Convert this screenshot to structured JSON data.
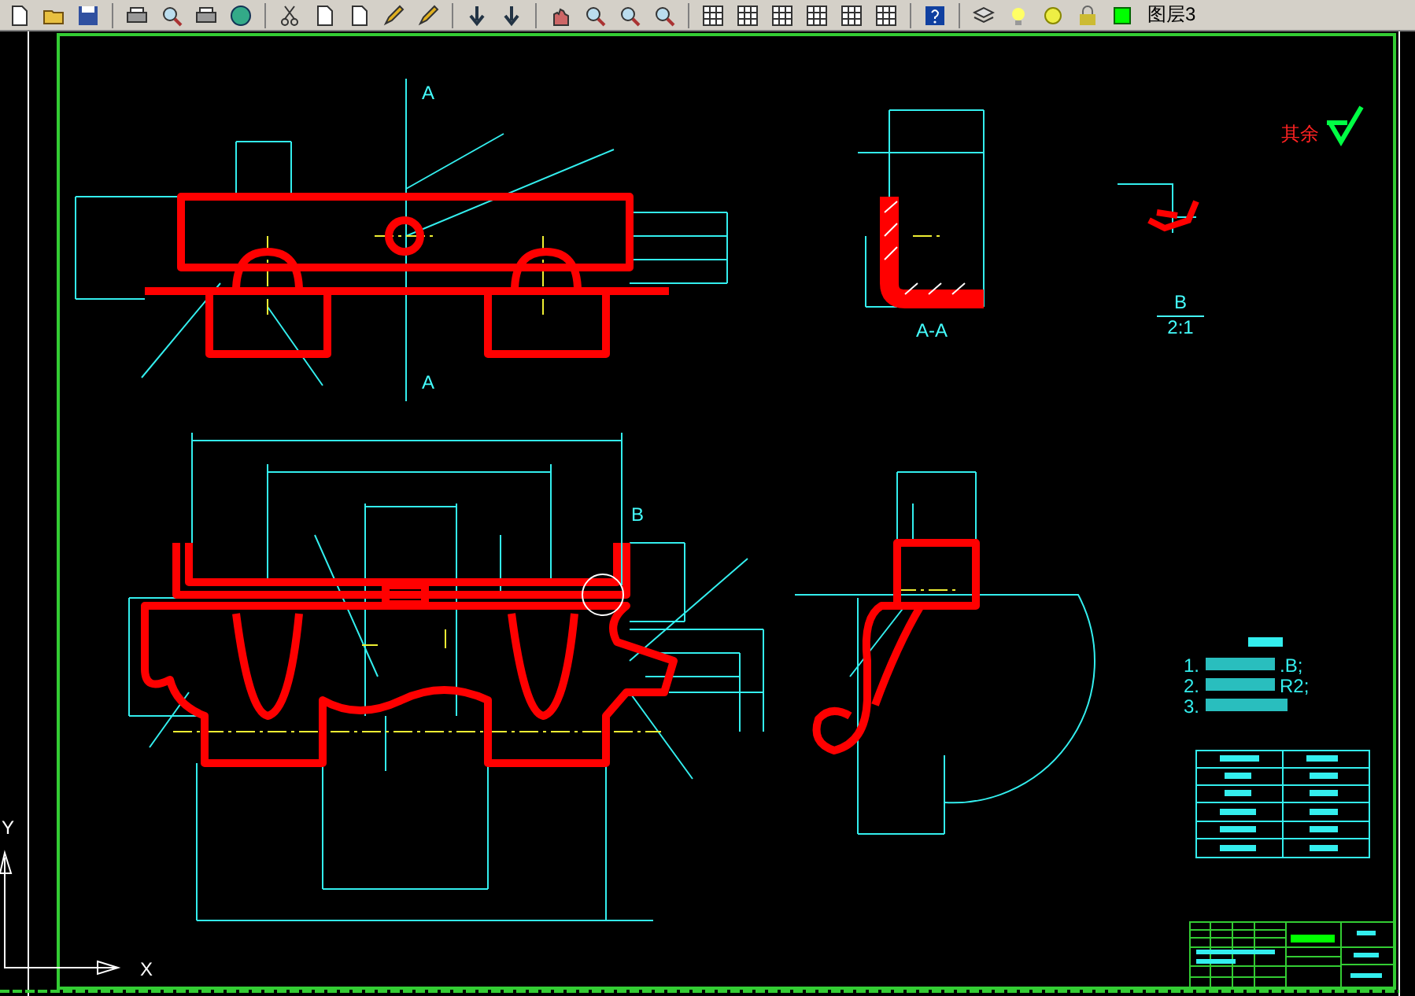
{
  "toolbar": {
    "layer_name": "图层3"
  },
  "drawing": {
    "labels": [
      {
        "kind": "section",
        "text": "A"
      },
      {
        "kind": "section",
        "text": "A"
      },
      {
        "kind": "section",
        "text": "A-A"
      },
      {
        "kind": "section",
        "text": "B"
      },
      {
        "kind": "scale",
        "text": "2:1"
      },
      {
        "kind": "section",
        "text": "B"
      },
      {
        "kind": "roughness",
        "text": "其余"
      }
    ],
    "notes": [
      {
        "number": "1.",
        "tail": ".B;"
      },
      {
        "number": "2.",
        "tail": "R2;"
      },
      {
        "number": "3."
      }
    ],
    "ucs": {
      "x_label": "X",
      "y_label": "Y"
    }
  }
}
